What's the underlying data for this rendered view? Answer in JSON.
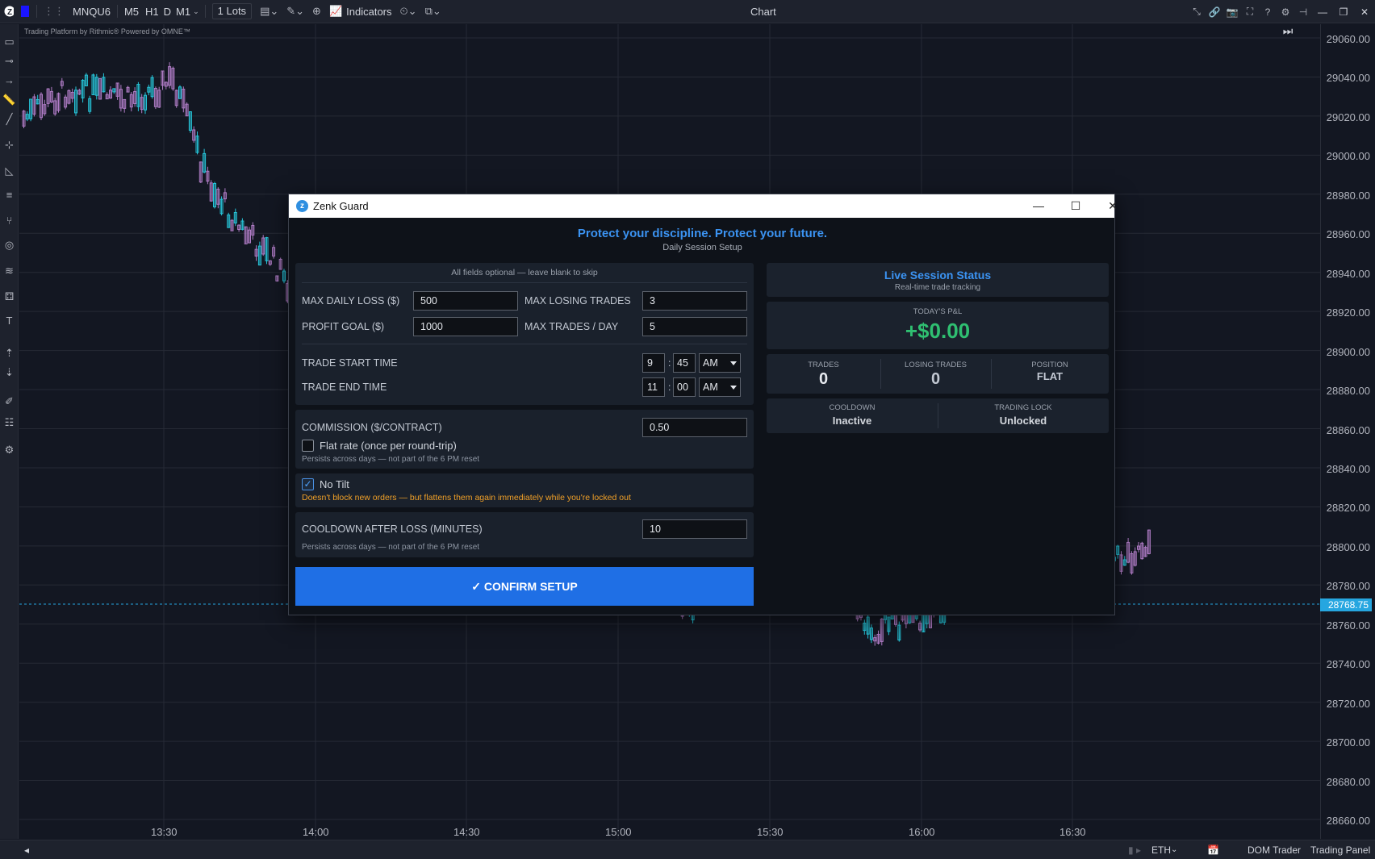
{
  "toolbar": {
    "symbol": "MNQU6",
    "timeframes": [
      "M5",
      "H1",
      "D",
      "M1"
    ],
    "lots": "1 Lots",
    "indicators": "Indicators",
    "title": "Chart"
  },
  "watermark": "Trading Platform by Rithmic®  Powered by OMNE™",
  "price_axis": {
    "labels": [
      "29060.00",
      "29040.00",
      "29020.00",
      "29000.00",
      "28980.00",
      "28960.00",
      "28940.00",
      "28920.00",
      "28900.00",
      "28880.00",
      "28860.00",
      "28840.00",
      "28820.00",
      "28800.00",
      "28780.00",
      "28760.00",
      "28740.00",
      "28720.00",
      "28700.00",
      "28680.00",
      "28660.00"
    ],
    "last_price": "28768.75"
  },
  "time_axis": [
    "13:30",
    "14:00",
    "14:30",
    "15:00",
    "15:30",
    "16:00",
    "16:30"
  ],
  "bottom_bar": {
    "session": "ETH",
    "dom_trader": "DOM Trader",
    "trading_panel": "Trading Panel"
  },
  "colors": {
    "bull": "#26c6da",
    "bear": "#b07cc6",
    "accent": "#1f6fe5",
    "title_blue": "#3b93f2",
    "profit": "#2fbf71",
    "warn": "#f0a028"
  },
  "modal": {
    "title": "Zenk Guard",
    "headline": "Protect your discipline. Protect your future.",
    "subhead": "Daily Session Setup",
    "hint": "All fields optional — leave blank to skip",
    "max_daily_loss_label": "MAX DAILY LOSS ($)",
    "max_daily_loss": "500",
    "max_losing_trades_label": "MAX LOSING TRADES",
    "max_losing_trades": "3",
    "profit_goal_label": "PROFIT GOAL ($)",
    "profit_goal": "1000",
    "max_trades_label": "MAX TRADES / DAY",
    "max_trades": "5",
    "start_label": "TRADE START TIME",
    "start_hour": "9",
    "start_min": "45",
    "start_ampm": "AM",
    "end_label": "TRADE END TIME",
    "end_hour": "11",
    "end_min": "00",
    "end_ampm": "AM",
    "colon": ":",
    "commission_label": "COMMISSION ($/CONTRACT)",
    "commission": "0.50",
    "flat_rate_label": "Flat rate (once per round-trip)",
    "persist_note": "Persists across days — not part of the 6 PM reset",
    "no_tilt_label": "No Tilt",
    "no_tilt_note": "Doesn't block new orders — but flattens them again immediately while you're locked out",
    "cooldown_label": "COOLDOWN AFTER LOSS (MINUTES)",
    "cooldown": "10",
    "confirm": "✓  CONFIRM SETUP"
  },
  "status": {
    "title": "Live Session Status",
    "subtitle": "Real-time trade tracking",
    "pnl_label": "TODAY'S P&L",
    "pnl": "+$0.00",
    "trades_label": "TRADES",
    "trades": "0",
    "losing_label": "LOSING TRADES",
    "losing": "0",
    "position_label": "POSITION",
    "position": "FLAT",
    "cooldown_label": "COOLDOWN",
    "cooldown": "Inactive",
    "lock_label": "TRADING LOCK",
    "lock": "Unlocked"
  }
}
